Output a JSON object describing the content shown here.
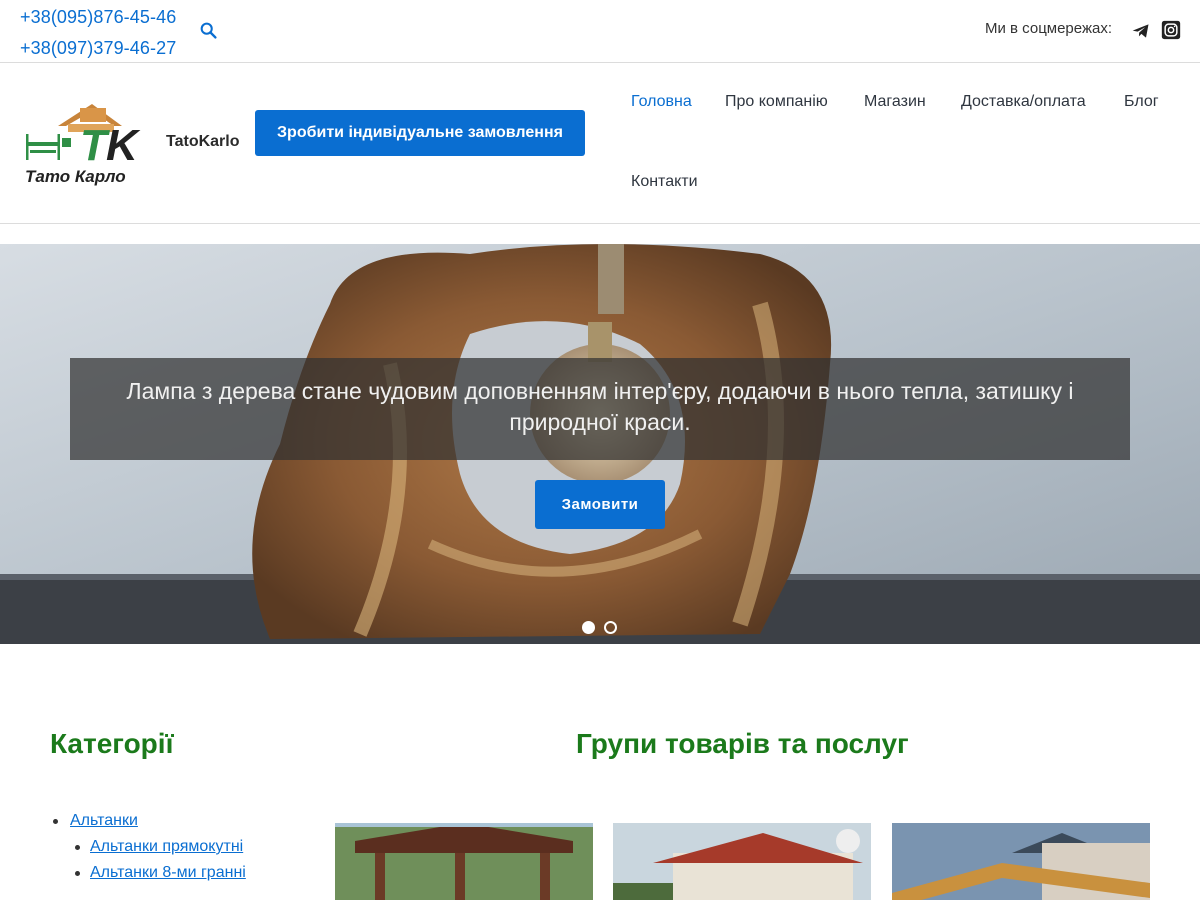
{
  "topbar": {
    "phones": [
      "+38(095)876-45-46",
      "+38(097)379-46-27"
    ],
    "social_label": "Ми в соцмережах:",
    "icons": [
      "search-icon",
      "telegram-icon",
      "instagram-icon"
    ]
  },
  "header": {
    "logo_text": "Тато Карло",
    "logo_letters": "TK",
    "site_name": "TatoKarlo",
    "order_button": "Зробити індивідуальне замовлення",
    "nav": [
      {
        "label": "Головна",
        "active": true
      },
      {
        "label": "Про компанію",
        "active": false
      },
      {
        "label": "Магазин",
        "active": false
      },
      {
        "label": "Доставка/оплата",
        "active": false
      },
      {
        "label": "Блог",
        "active": false
      },
      {
        "label": "Контакти",
        "active": false
      }
    ]
  },
  "hero": {
    "caption": "Лампа з дерева стане чудовим доповненням інтер'єру, додаючи в нього тепла, затишку і природної краси.",
    "button": "Замовити",
    "slides_count": 2,
    "active_slide": 1
  },
  "content": {
    "categories_heading": "Категорії",
    "groups_heading": "Групи товарів та послуг",
    "categories": [
      {
        "label": "Альтанки",
        "level": 1
      },
      {
        "label": "Альтанки прямокутні",
        "level": 2
      },
      {
        "label": "Альтанки 8-ми гранні",
        "level": 2
      }
    ],
    "group_cards_count": 3
  },
  "colors": {
    "accent_blue": "#0a6ed1",
    "heading_green": "#1b7a1b"
  }
}
